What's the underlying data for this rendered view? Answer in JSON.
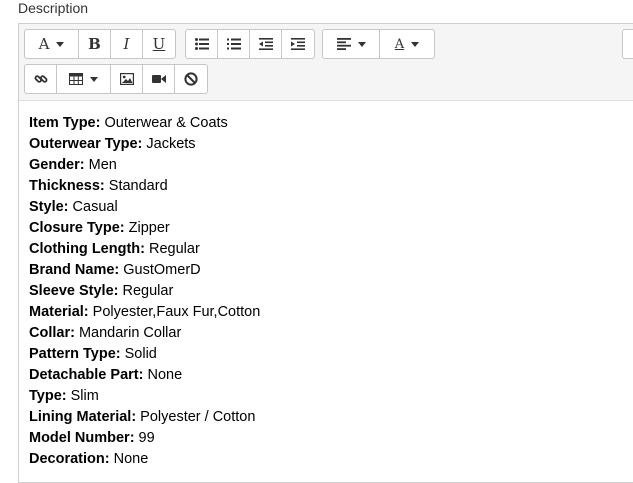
{
  "field_label": "Description",
  "toolbar": {
    "font_button": "A",
    "bold": "B",
    "italic": "I",
    "underline": "U",
    "font_color_button": "A"
  },
  "content": {
    "rows": [
      {
        "label": "Item Type:",
        "value": " Outerwear & Coats"
      },
      {
        "label": "Outerwear Type:",
        "value": " Jackets"
      },
      {
        "label": "Gender:",
        "value": " Men"
      },
      {
        "label": "Thickness:",
        "value": " Standard"
      },
      {
        "label": "Style:",
        "value": " Casual"
      },
      {
        "label": "Closure Type:",
        "value": " Zipper"
      },
      {
        "label": "Clothing Length:",
        "value": " Regular"
      },
      {
        "label": "Brand Name:",
        "value": " GustOmerD"
      },
      {
        "label": "Sleeve Style:",
        "value": " Regular"
      },
      {
        "label": "Material:",
        "value": " Polyester,Faux Fur,Cotton"
      },
      {
        "label": "Collar:",
        "value": " Mandarin Collar"
      },
      {
        "label": "Pattern Type:",
        "value": " Solid"
      },
      {
        "label": "Detachable Part:",
        "value": " None"
      },
      {
        "label": "Type:",
        "value": " Slim"
      },
      {
        "label": "Lining Material:",
        "value": " Polyester / Cotton"
      },
      {
        "label": "Model Number:",
        "value": " 99"
      },
      {
        "label": "Decoration:",
        "value": " None"
      }
    ]
  }
}
